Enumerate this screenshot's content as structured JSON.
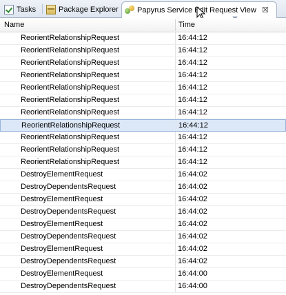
{
  "tabs": [
    {
      "label": "Tasks",
      "icon": "tasks-icon",
      "active": false
    },
    {
      "label": "Package Explorer",
      "icon": "package-explorer-icon",
      "active": false
    },
    {
      "label": "Papyrus Service Edit Request View",
      "icon": "papyrus-icon",
      "active": true
    }
  ],
  "close_glyph": "☒",
  "columns": {
    "name": "Name",
    "time": "Time"
  },
  "selected_row": 7,
  "rows": [
    {
      "name": "ReorientRelationshipRequest",
      "time": "16:44:12"
    },
    {
      "name": "ReorientRelationshipRequest",
      "time": "16:44:12"
    },
    {
      "name": "ReorientRelationshipRequest",
      "time": "16:44:12"
    },
    {
      "name": "ReorientRelationshipRequest",
      "time": "16:44:12"
    },
    {
      "name": "ReorientRelationshipRequest",
      "time": "16:44:12"
    },
    {
      "name": "ReorientRelationshipRequest",
      "time": "16:44:12"
    },
    {
      "name": "ReorientRelationshipRequest",
      "time": "16:44:12"
    },
    {
      "name": "ReorientRelationshipRequest",
      "time": "16:44:12"
    },
    {
      "name": "ReorientRelationshipRequest",
      "time": "16:44:12"
    },
    {
      "name": "ReorientRelationshipRequest",
      "time": "16:44:12"
    },
    {
      "name": "ReorientRelationshipRequest",
      "time": "16:44:12"
    },
    {
      "name": "DestroyElementRequest",
      "time": "16:44:02"
    },
    {
      "name": "DestroyDependentsRequest",
      "time": "16:44:02"
    },
    {
      "name": "DestroyElementRequest",
      "time": "16:44:02"
    },
    {
      "name": "DestroyDependentsRequest",
      "time": "16:44:02"
    },
    {
      "name": "DestroyElementRequest",
      "time": "16:44:02"
    },
    {
      "name": "DestroyDependentsRequest",
      "time": "16:44:02"
    },
    {
      "name": "DestroyElementRequest",
      "time": "16:44:02"
    },
    {
      "name": "DestroyDependentsRequest",
      "time": "16:44:02"
    },
    {
      "name": "DestroyElementRequest",
      "time": "16:44:00"
    },
    {
      "name": "DestroyDependentsRequest",
      "time": "16:44:00"
    }
  ]
}
